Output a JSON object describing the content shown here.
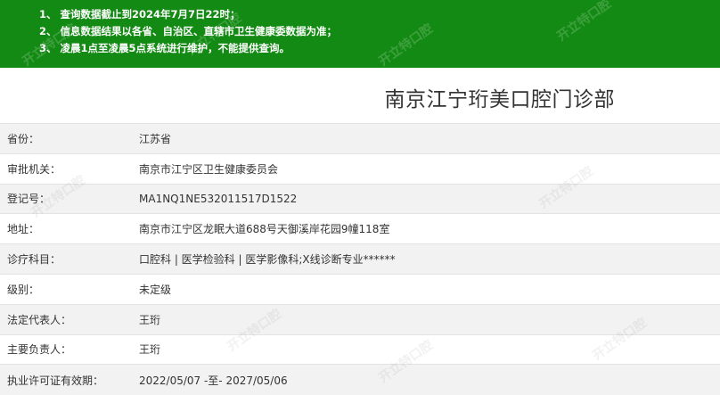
{
  "notice": {
    "lines": [
      "1、 查询数据截止到2024年7月7日22时；",
      "2、 信息数据结果以各省、自治区、直辖市卫生健康委数据为准；",
      "3、 凌晨1点至凌晨5点系统进行维护，不能提供查询。"
    ],
    "background_color": "#138a13"
  },
  "clinic": {
    "name": "南京江宁珩美口腔门诊部"
  },
  "fields": [
    {
      "label": "省份：",
      "value": "江苏省"
    },
    {
      "label": "审批机关：",
      "value": "南京市江宁区卫生健康委员会"
    },
    {
      "label": "登记号：",
      "value": "MA1NQ1NE532011517D1522"
    },
    {
      "label": "地址：",
      "value": "南京市江宁区龙眠大道688号天御溪岸花园9幢118室"
    },
    {
      "label": "诊疗科目：",
      "value": "口腔科 | 医学检验科 | 医学影像科;X线诊断专业******"
    },
    {
      "label": "级别：",
      "value": "未定级"
    },
    {
      "label": "法定代表人：",
      "value": "王珩"
    },
    {
      "label": "主要负责人：",
      "value": "王珩"
    },
    {
      "label": "执业许可证有效期：",
      "value": "2022/05/07 -至- 2027/05/06"
    }
  ],
  "watermark": {
    "text": "开立特口腔",
    "subtext": "kaiyite.com"
  }
}
